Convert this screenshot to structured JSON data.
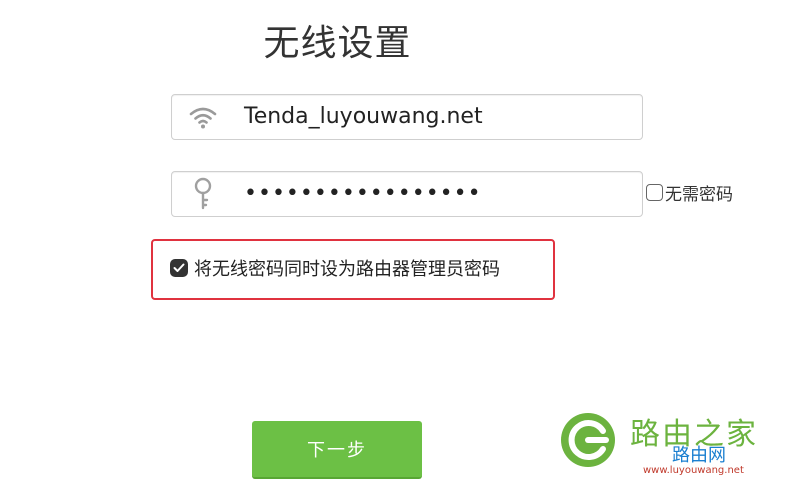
{
  "page": {
    "title": "无线设置"
  },
  "ssid": {
    "value": "Tenda_luyouwang.net",
    "icon": "wifi-icon"
  },
  "password": {
    "value": "•••••••••••••••••",
    "icon": "key-icon"
  },
  "no_password": {
    "label": "无需密码",
    "checked": false
  },
  "admin_sync": {
    "label": "将无线密码同时设为路由器管理员密码",
    "checked": true
  },
  "next_button": {
    "label": "下一步"
  },
  "watermark": {
    "title": "路由之家",
    "sub": "路由网",
    "url": "www.luyouwang.net"
  },
  "colors": {
    "accent_green": "#6cc045",
    "highlight_red": "#e0323f"
  }
}
